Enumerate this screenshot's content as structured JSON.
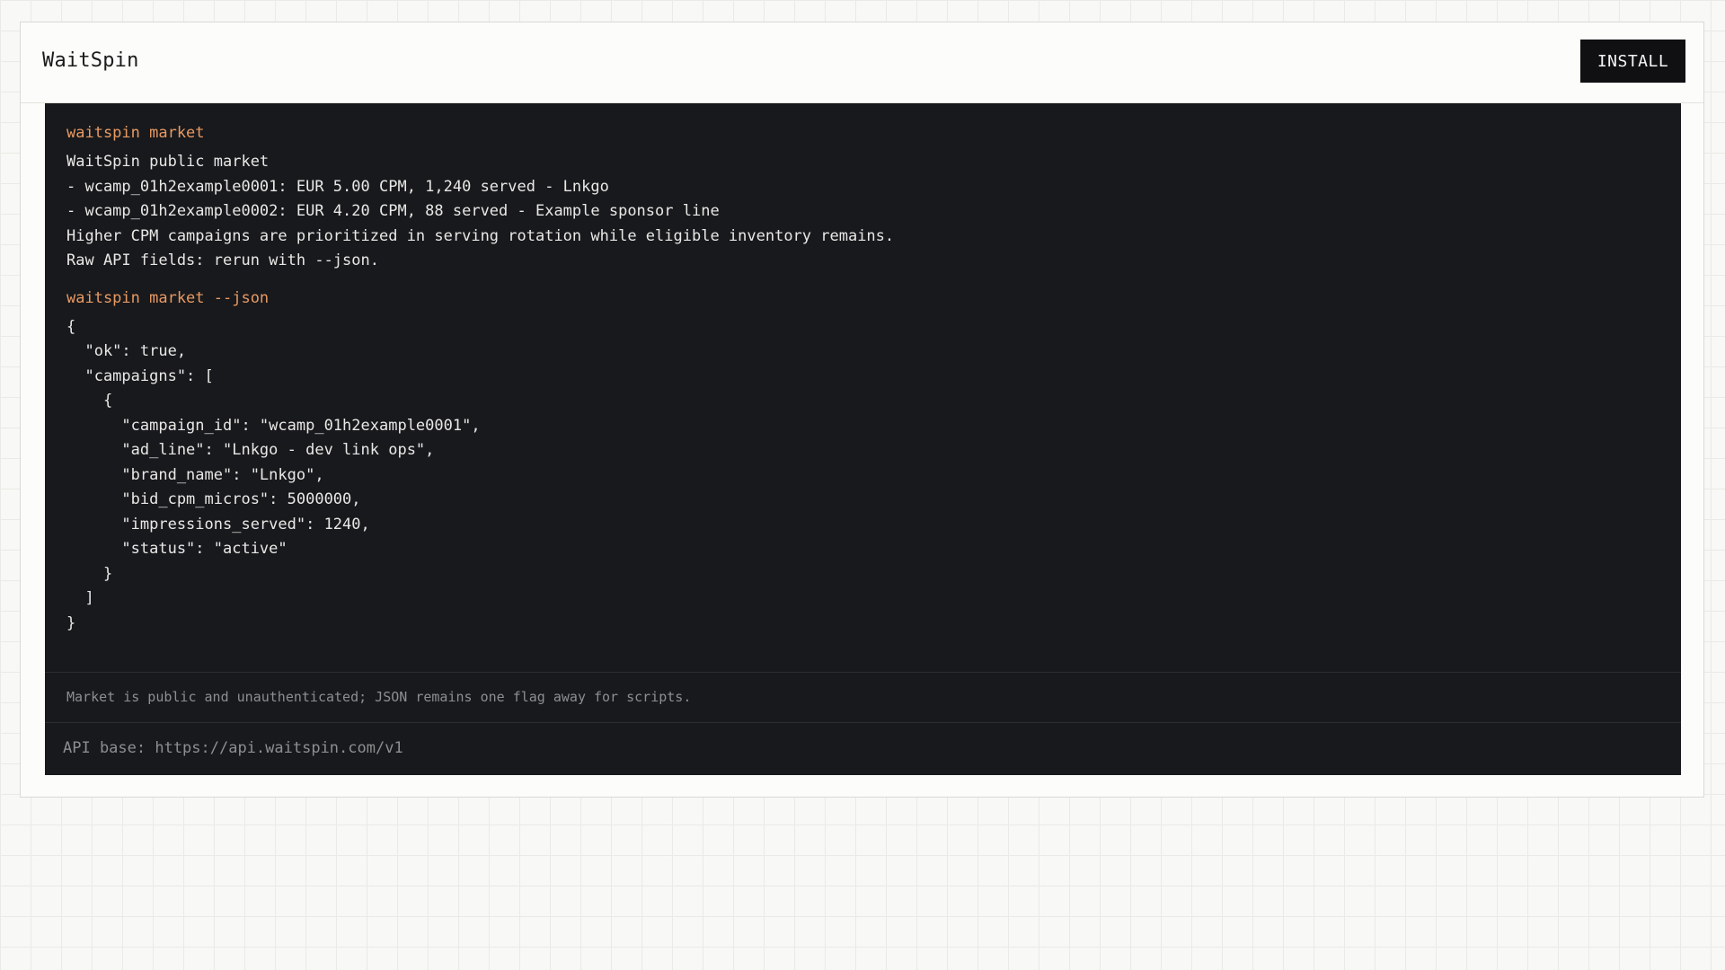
{
  "app": {
    "title": "WaitSpin",
    "install_label": "INSTALL"
  },
  "terminal": {
    "blocks": [
      {
        "command": "waitspin market",
        "output": [
          "WaitSpin public market",
          "- wcamp_01h2example0001: EUR 5.00 CPM, 1,240 served - Lnkgo",
          "- wcamp_01h2example0002: EUR 4.20 CPM, 88 served - Example sponsor line",
          "Higher CPM campaigns are prioritized in serving rotation while eligible inventory remains.",
          "Raw API fields: rerun with --json."
        ]
      },
      {
        "command": "waitspin market --json",
        "output": [
          "{",
          "  \"ok\": true,",
          "  \"campaigns\": [",
          "    {",
          "      \"campaign_id\": \"wcamp_01h2example0001\",",
          "      \"ad_line\": \"Lnkgo - dev link ops\",",
          "      \"brand_name\": \"Lnkgo\",",
          "      \"bid_cpm_micros\": 5000000,",
          "      \"impressions_served\": 1240,",
          "      \"status\": \"active\"",
          "    }",
          "  ]",
          "}"
        ]
      }
    ],
    "notice": "Market is public and unauthenticated; JSON remains one flag away for scripts.",
    "api_base": "API base: https://api.waitspin.com/v1"
  },
  "colors": {
    "command": "#e89a63",
    "terminal_bg": "#18191c",
    "button_bg": "#101012"
  }
}
